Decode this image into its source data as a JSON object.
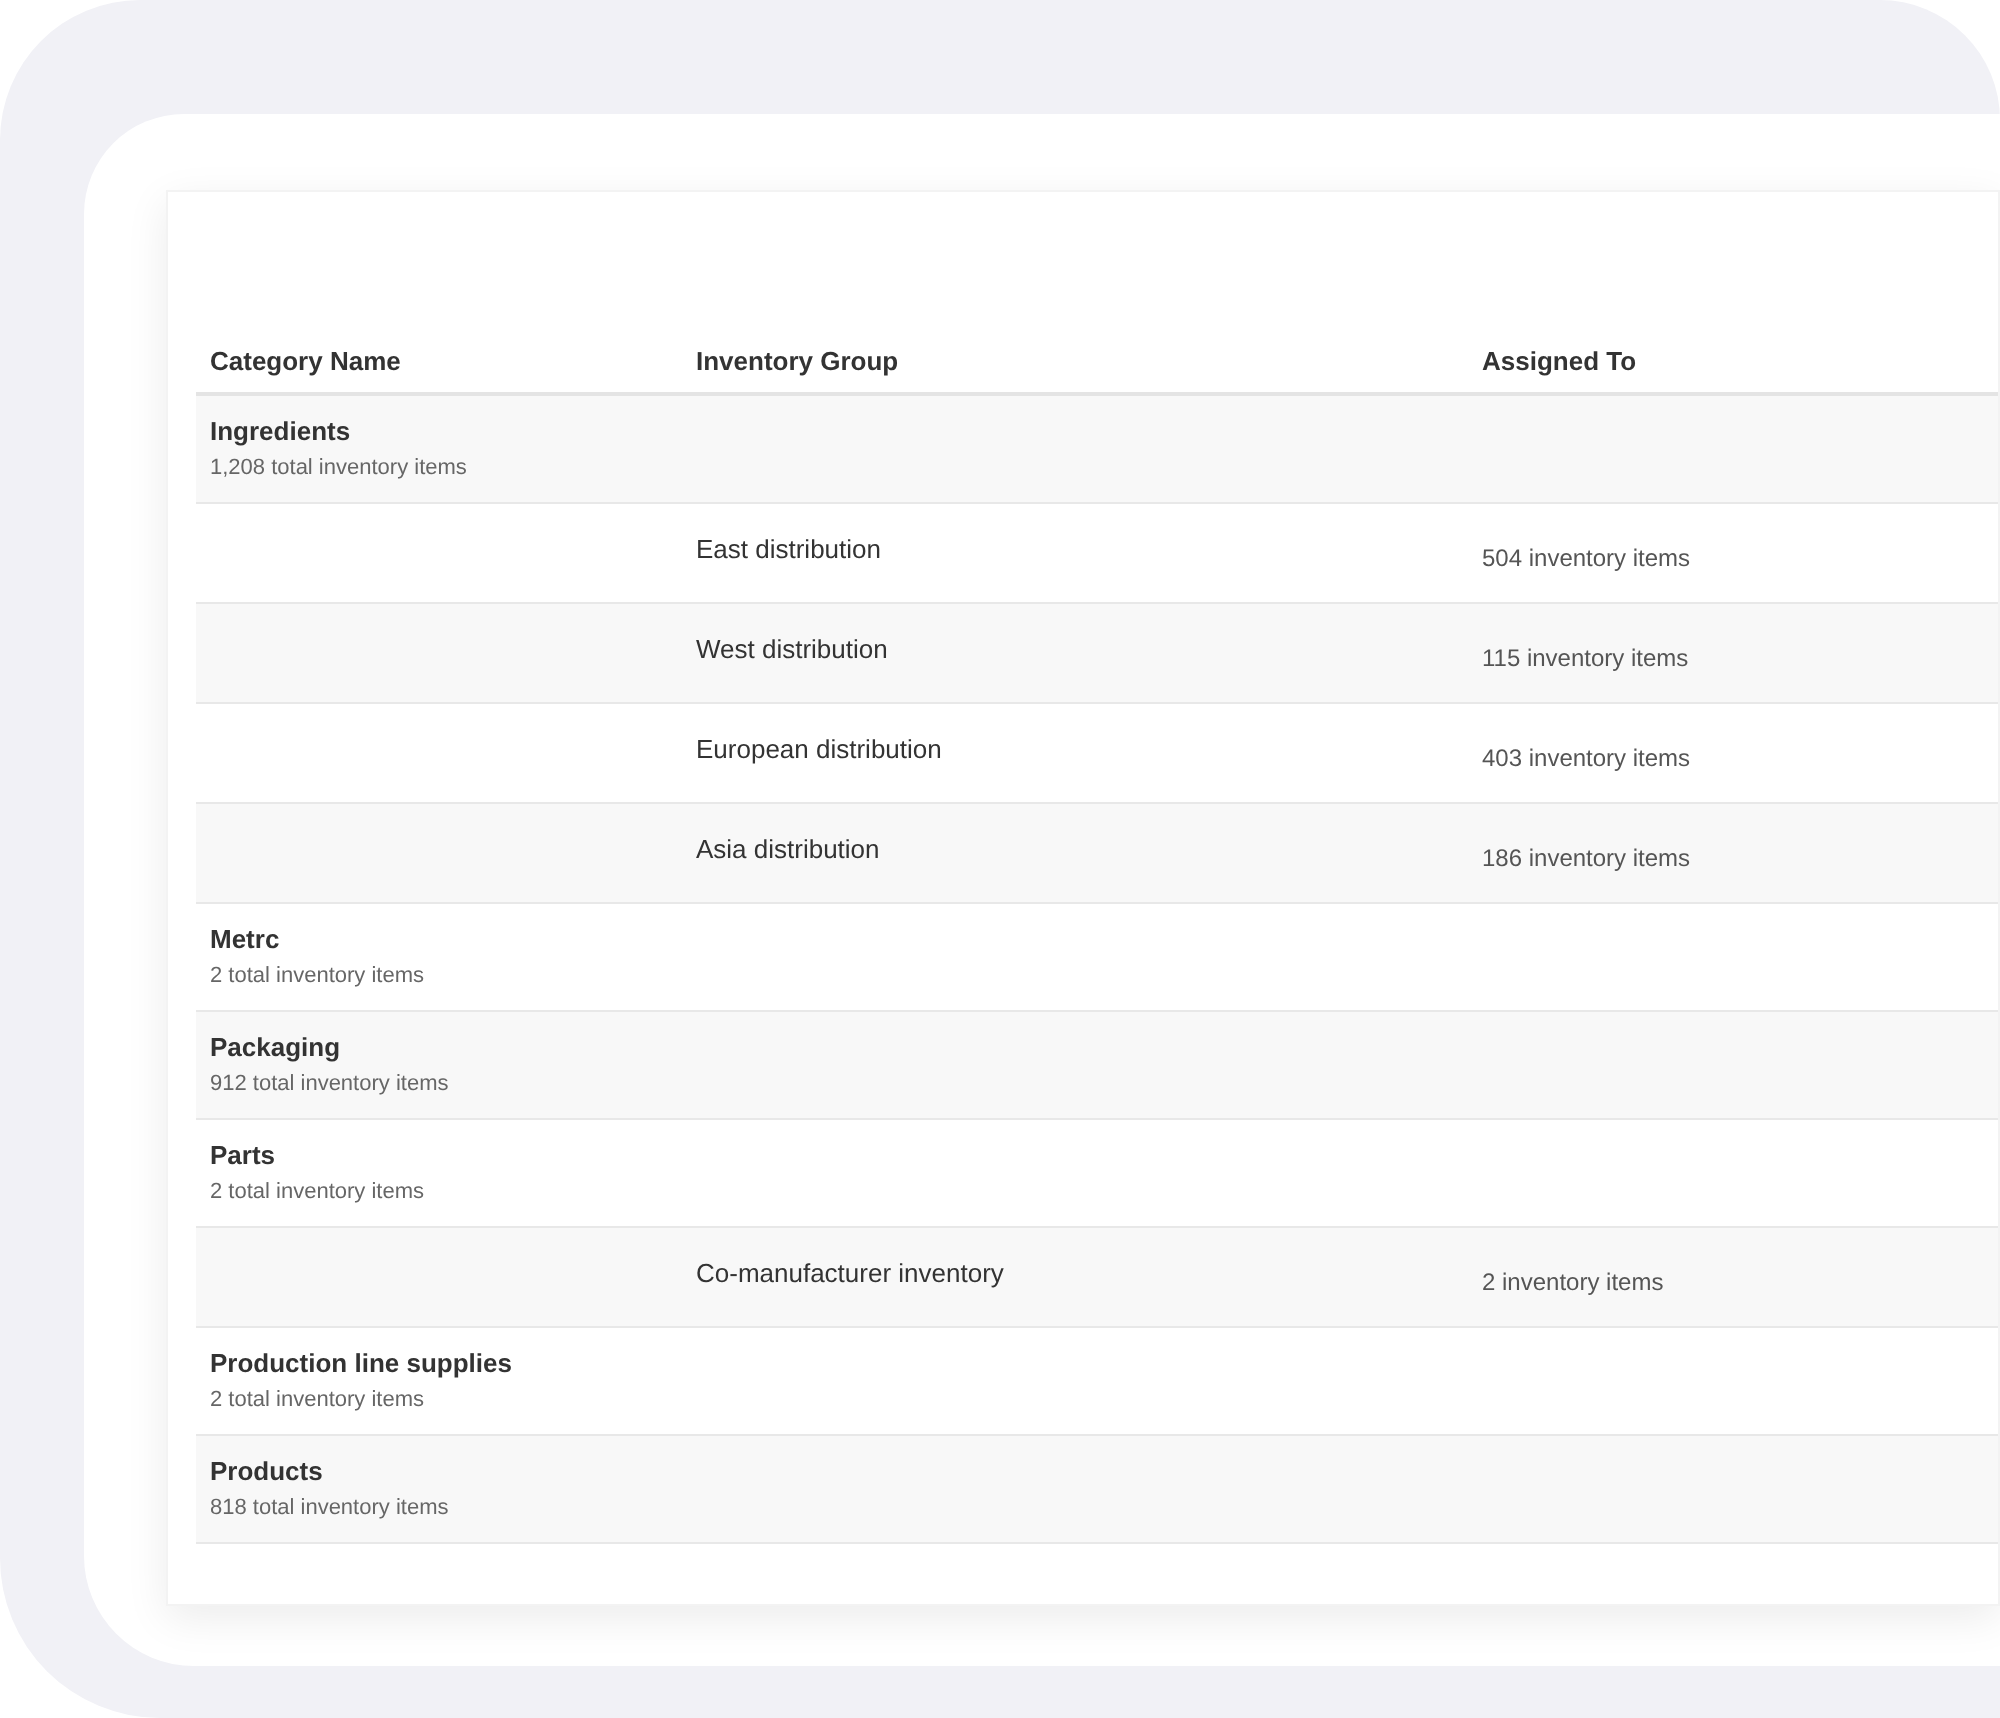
{
  "table": {
    "columns": [
      "Category Name",
      "Inventory Group",
      "Assigned To"
    ],
    "rows": [
      {
        "kind": "category",
        "name": "Ingredients",
        "total": "1,208 total inventory items"
      },
      {
        "kind": "group",
        "group": "East distribution",
        "assigned": "504 inventory items"
      },
      {
        "kind": "group",
        "group": "West distribution",
        "assigned": "115 inventory items"
      },
      {
        "kind": "group",
        "group": "European distribution",
        "assigned": "403 inventory items"
      },
      {
        "kind": "group",
        "group": "Asia distribution",
        "assigned": "186 inventory items"
      },
      {
        "kind": "category",
        "name": "Metrc",
        "total": "2 total inventory items"
      },
      {
        "kind": "category",
        "name": "Packaging",
        "total": "912 total inventory items"
      },
      {
        "kind": "category",
        "name": "Parts",
        "total": "2 total inventory items"
      },
      {
        "kind": "group",
        "group": "Co-manufacturer inventory",
        "assigned": "2 inventory items"
      },
      {
        "kind": "category",
        "name": "Production line supplies",
        "total": "2 total inventory items"
      },
      {
        "kind": "category",
        "name": "Products",
        "total": "818 total inventory items"
      }
    ]
  }
}
